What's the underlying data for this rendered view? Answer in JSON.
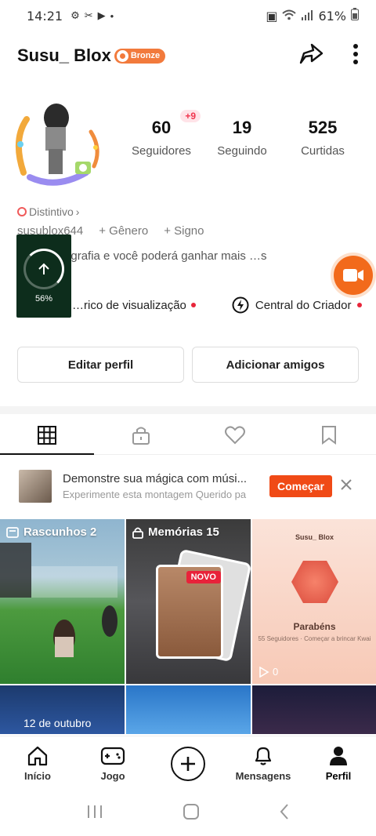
{
  "status_bar": {
    "time": "14:21",
    "battery": "61%"
  },
  "header": {
    "username": "Susu_ Blox",
    "badge": "Bronze"
  },
  "stats": [
    {
      "value": "60",
      "label": "Seguidores",
      "delta": "+9"
    },
    {
      "value": "19",
      "label": "Seguindo"
    },
    {
      "value": "525",
      "label": "Curtidas"
    }
  ],
  "profile": {
    "distintivo": "Distintivo",
    "handle": "susublox644",
    "genero": "+ Gênero",
    "signo": "+ Signo",
    "bio": "…uma biografia e você poderá ganhar mais …s"
  },
  "upload": {
    "percent": "56%",
    "progress": 0.56
  },
  "links": {
    "historico": "…rico de visualização",
    "creator": "Central do Criador"
  },
  "buttons": {
    "edit": "Editar perfil",
    "add_friends": "Adicionar amigos"
  },
  "promo": {
    "title": "Demonstre sua mágica com músi...",
    "subtitle": "Experimente esta montagem Querido pa",
    "cta": "Começar"
  },
  "grid": {
    "drafts_label": "Rascunhos 2",
    "memories_label": "Memórias 15",
    "novo": "NOVO",
    "card3_user": "Susu_ Blox",
    "card3_title": "Parabéns",
    "card3_sub": "55 Seguidores · Começar a brincar Kwai",
    "card3_views": "0",
    "date_tag": "12 de outubro"
  },
  "bottom_nav": [
    {
      "label": "Início"
    },
    {
      "label": "Jogo"
    },
    {
      "label": ""
    },
    {
      "label": "Mensagens"
    },
    {
      "label": "Perfil"
    }
  ],
  "colors": {
    "accent": "#f04a16",
    "bronze": "#f27a3c",
    "notify_red": "#e8253a"
  }
}
